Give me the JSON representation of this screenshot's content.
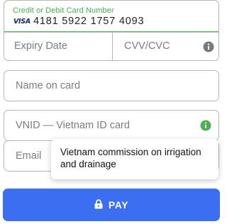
{
  "card": {
    "number_label": "Credit or Debit Card Number",
    "brand": "VISA",
    "number_value": "4181 5922 1757 4093",
    "expiry_placeholder": "Expiry Date",
    "cvv_placeholder": "CVV/CVC"
  },
  "fields": {
    "name_placeholder": "Name on card",
    "vnid_placeholder": "VNID — Vietnam ID card",
    "email_placeholder": "Email"
  },
  "tooltip": {
    "text": "Vietnam commission on irrigation and drainage"
  },
  "pay_button": {
    "label": "PAY"
  },
  "icons": {
    "cvv_info": "info-icon",
    "vnid_info": "info-icon",
    "pay": "lock-icon"
  },
  "colors": {
    "accent_green": "#4ab052",
    "button_blue": "#3b6ef0",
    "border_grey": "#b5b7bc",
    "visa_blue": "#1a1f71"
  }
}
